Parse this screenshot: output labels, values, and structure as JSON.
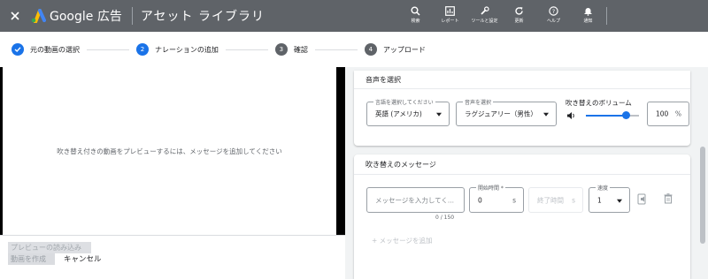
{
  "header": {
    "brand": "Google 広告",
    "page_title": "アセット ライブラリ",
    "actions": [
      {
        "icon": "search-icon",
        "label": "検索"
      },
      {
        "icon": "report-icon",
        "label": "レポート"
      },
      {
        "icon": "tools-icon",
        "label": "ツールと設定"
      },
      {
        "icon": "refresh-icon",
        "label": "更新"
      },
      {
        "icon": "help-icon",
        "label": "ヘルプ"
      },
      {
        "icon": "bell-icon",
        "label": "通知"
      }
    ]
  },
  "stepper": {
    "steps": [
      {
        "number": "",
        "label": "元の動画の選択",
        "state": "done"
      },
      {
        "number": "2",
        "label": "ナレーションの追加",
        "state": "active"
      },
      {
        "number": "3",
        "label": "確認",
        "state": "todo"
      },
      {
        "number": "4",
        "label": "アップロード",
        "state": "todo"
      }
    ]
  },
  "preview": {
    "message": "吹き替え付きの動画をプレビューするには、メッセージを追加してください"
  },
  "bottom": {
    "load_preview": "プレビューの読み込み",
    "create_video": "動画を作成",
    "cancel": "キャンセル"
  },
  "voice_card": {
    "title": "音声を選択",
    "language_label": "言語を選択してください",
    "language_value": "英語 (アメリカ)",
    "voice_label": "音声を選択",
    "voice_value": "ラグジュアリー（男性）",
    "volume_label": "吹き替えのボリューム",
    "volume_value": "100",
    "volume_unit": "%",
    "volume_fraction": 0.75
  },
  "message_card": {
    "title": "吹き替えのメッセージ",
    "message_placeholder": "メッセージを入力してく...",
    "char_count": "0 / 150",
    "start_label": "開始時間 *",
    "start_value": "0",
    "start_unit": "s",
    "end_placeholder": "終了時間",
    "end_unit": "s",
    "speed_label": "速度",
    "speed_value": "1",
    "add_message": "+ メッセージを追加"
  }
}
